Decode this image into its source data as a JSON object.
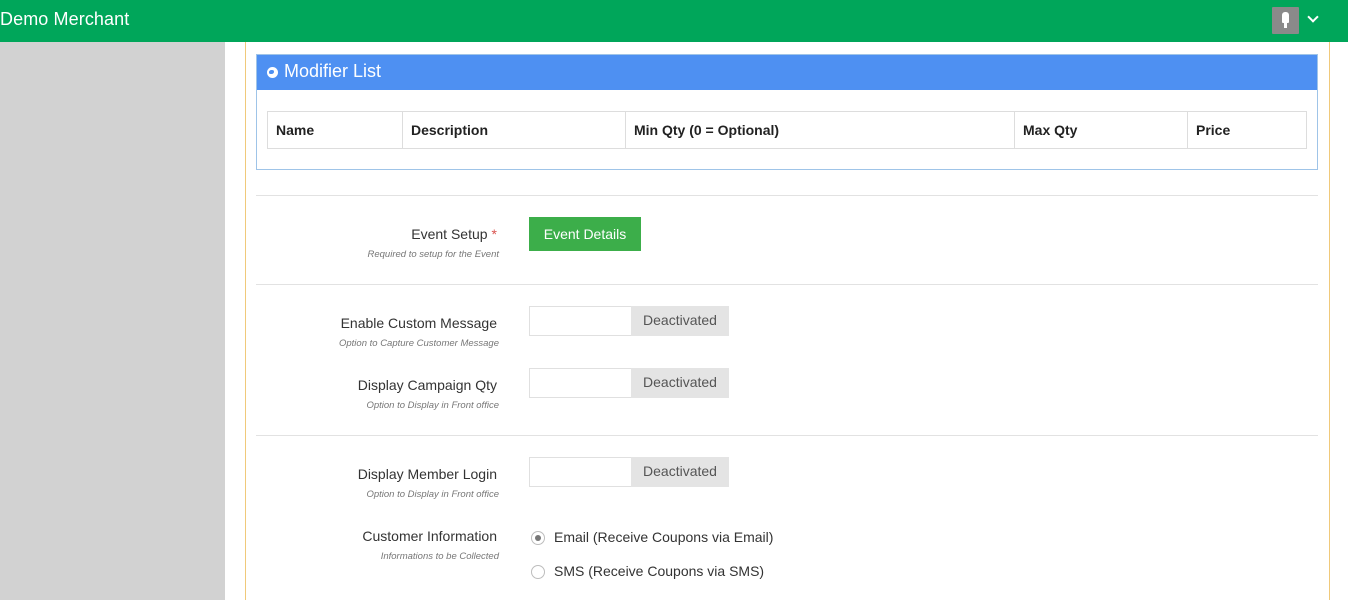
{
  "header": {
    "brand": "Demo Merchant",
    "avatar_icon": "user-avatar-icon",
    "menu_icon": "chevron-down-icon"
  },
  "modifier_panel": {
    "title": "Modifier List",
    "icon": "globe-icon",
    "columns": [
      "Name",
      "Description",
      "Min Qty (0 = Optional)",
      "Max Qty",
      "Price"
    ]
  },
  "event_setup": {
    "label": "Event Setup",
    "required_mark": "*",
    "hint": "Required to setup for the Event",
    "button_label": "Event Details"
  },
  "custom_message": {
    "label": "Enable Custom Message",
    "hint": "Option to Capture Customer Message",
    "state": "Deactivated"
  },
  "campaign_qty": {
    "label": "Display Campaign Qty",
    "hint": "Option to Display in Front office",
    "state": "Deactivated"
  },
  "member_login": {
    "label": "Display Member Login",
    "hint": "Option to Display in Front office",
    "state": "Deactivated"
  },
  "customer_info": {
    "label": "Customer Information",
    "hint": "Informations to be Collected",
    "options": [
      {
        "label": "Email (Receive Coupons via Email)",
        "selected": true
      },
      {
        "label": "SMS (Receive Coupons via SMS)",
        "selected": false
      }
    ]
  },
  "colors": {
    "topbar": "#00a65a",
    "panel_header": "#4e90f2",
    "button": "#3cae4a",
    "sidebar": "#d2d2d2"
  }
}
